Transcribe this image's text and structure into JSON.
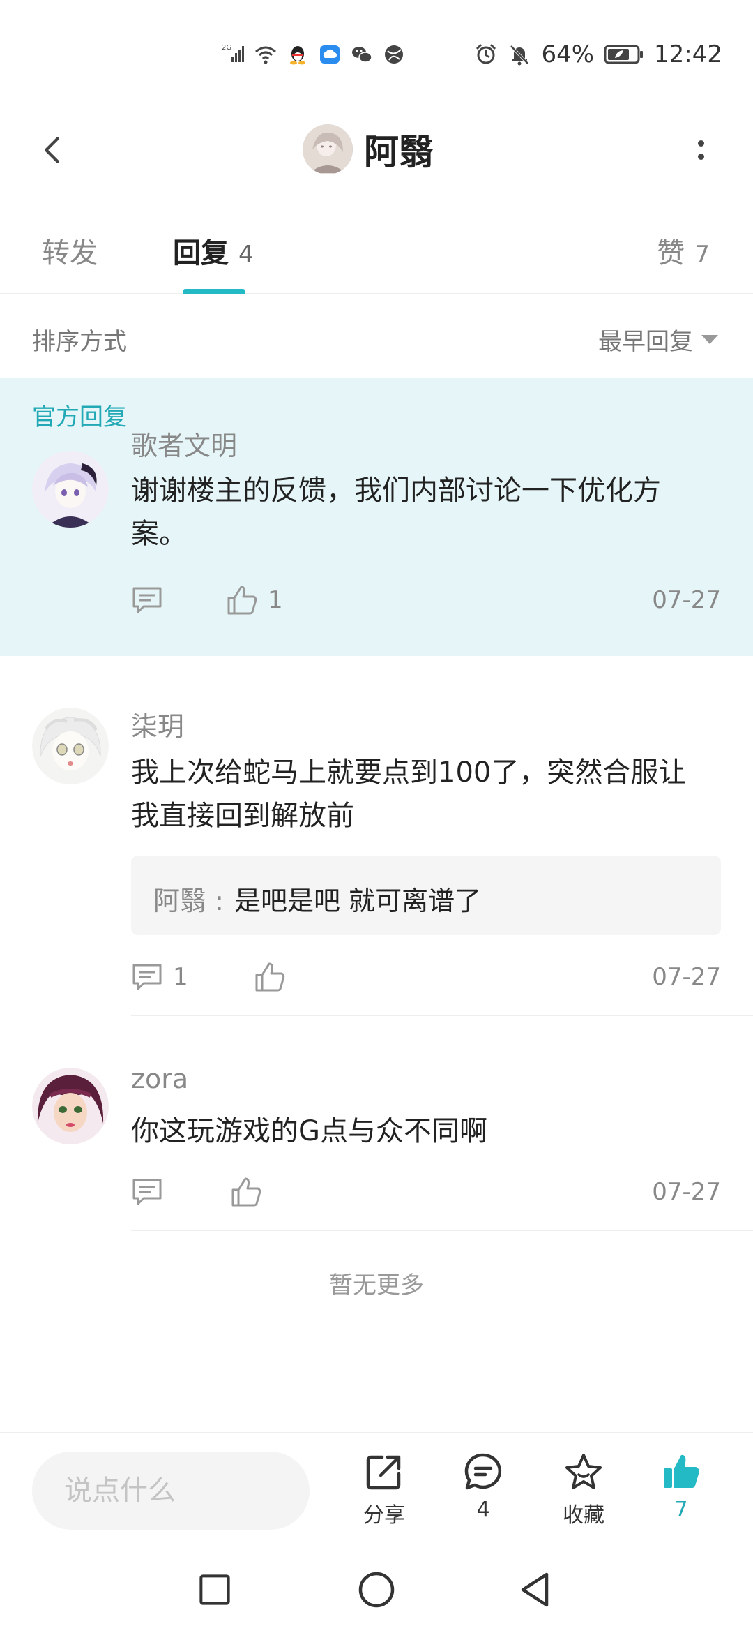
{
  "status_bar": {
    "network": "2G",
    "battery": "64%",
    "time": "12:42"
  },
  "header": {
    "title": "阿翳"
  },
  "tabs": {
    "forward_label": "转发",
    "reply_label": "回复",
    "reply_count": "4",
    "like_label": "赞",
    "like_count": "7"
  },
  "sort": {
    "label": "排序方式",
    "selected": "最早回复"
  },
  "official": {
    "tag": "官方回复",
    "author": "歌者文明",
    "text": "谢谢楼主的反馈，我们内部讨论一下优化方案。",
    "like_count": "1",
    "date": "07-27"
  },
  "comments": [
    {
      "author": "柒玥",
      "text": "我上次给蛇马上就要点到100了，突然合服让我直接回到解放前",
      "quote_user": "阿翳 :",
      "quote_text": "是吧是吧 就可离谱了",
      "reply_count": "1",
      "date": "07-27"
    },
    {
      "author": "zora",
      "text": "你这玩游戏的G点与众不同啊",
      "date": "07-27"
    }
  ],
  "no_more": "暂无更多",
  "bottom_bar": {
    "input_placeholder": "说点什么",
    "share_label": "分享",
    "comment_count": "4",
    "favorite_label": "收藏",
    "like_count": "7"
  },
  "colors": {
    "accent": "#23b9c5",
    "official_bg": "#e6f6f8"
  }
}
